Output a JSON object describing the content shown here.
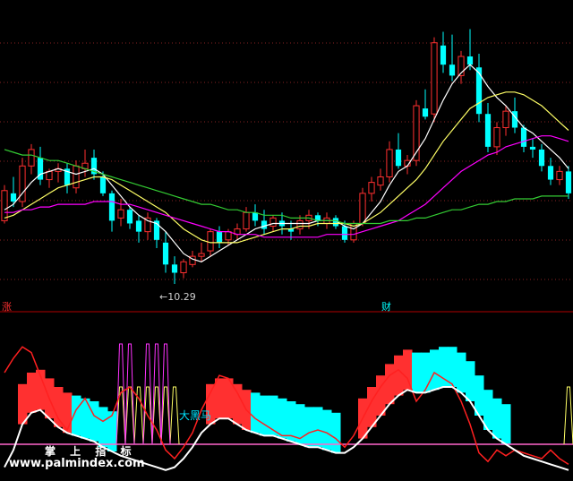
{
  "labels": {
    "rise_tag": "涨",
    "wealth_tag": "财",
    "signal_text": "大黑马",
    "low_price": "←10.29"
  },
  "watermark": {
    "title": "掌 上 指 标",
    "url": "www.palmindex.com"
  },
  "colors": {
    "background": "#000000",
    "up_candle": "#ff3030",
    "down_candle": "#00ffff",
    "ma_short": "#ffffff",
    "ma_mid": "#ffff66",
    "ma_long": "#ff00ff",
    "ma_longest": "#33cc33",
    "red_line": "#ff2020",
    "white_line": "#ffffff",
    "pink_baseline": "#ff66cc",
    "signal_yellow": "#ffff66",
    "signal_magenta": "#ff33ff",
    "grid": "#882222"
  },
  "chart_data": [
    {
      "type": "candlestick",
      "panel": "main",
      "ohlc": [
        [
          12.6,
          13.9,
          12.5,
          13.7
        ],
        [
          13.6,
          14.2,
          13.1,
          13.3
        ],
        [
          13.3,
          14.9,
          13.1,
          14.6
        ],
        [
          14.6,
          15.4,
          14.3,
          15.2
        ],
        [
          14.9,
          15.3,
          13.9,
          14.1
        ],
        [
          14.1,
          14.5,
          13.8,
          14.4
        ],
        [
          14.4,
          14.7,
          14.0,
          14.5
        ],
        [
          14.5,
          14.7,
          13.6,
          13.9
        ],
        [
          13.8,
          14.8,
          13.6,
          14.6
        ],
        [
          14.5,
          15.2,
          14.2,
          14.7
        ],
        [
          14.9,
          15.2,
          14.1,
          14.3
        ],
        [
          14.2,
          14.4,
          13.5,
          13.6
        ],
        [
          13.6,
          13.7,
          12.2,
          12.6
        ],
        [
          12.7,
          13.4,
          12.4,
          13.0
        ],
        [
          13.0,
          13.1,
          12.3,
          12.5
        ],
        [
          12.6,
          12.8,
          11.8,
          12.2
        ],
        [
          12.2,
          12.9,
          11.9,
          12.7
        ],
        [
          12.6,
          12.7,
          11.6,
          11.9
        ],
        [
          11.8,
          12.2,
          10.7,
          11.0
        ],
        [
          11.0,
          11.3,
          10.29,
          10.7
        ],
        [
          10.7,
          11.2,
          10.5,
          11.1
        ],
        [
          11.0,
          11.5,
          10.9,
          11.3
        ],
        [
          11.3,
          11.8,
          11.1,
          11.4
        ],
        [
          11.5,
          12.3,
          11.3,
          12.2
        ],
        [
          12.2,
          12.4,
          11.6,
          11.8
        ],
        [
          11.9,
          12.3,
          11.7,
          12.2
        ],
        [
          12.1,
          12.5,
          11.9,
          12.3
        ],
        [
          12.3,
          13.1,
          12.2,
          12.9
        ],
        [
          12.9,
          13.2,
          12.4,
          12.6
        ],
        [
          12.6,
          13.0,
          12.1,
          12.3
        ],
        [
          12.4,
          12.8,
          12.2,
          12.7
        ],
        [
          12.6,
          12.9,
          12.1,
          12.4
        ],
        [
          12.3,
          12.6,
          11.9,
          12.2
        ],
        [
          12.3,
          12.8,
          12.1,
          12.6
        ],
        [
          12.6,
          13.0,
          12.3,
          12.8
        ],
        [
          12.8,
          12.9,
          12.4,
          12.6
        ],
        [
          12.5,
          12.9,
          12.3,
          12.7
        ],
        [
          12.7,
          12.8,
          12.3,
          12.4
        ],
        [
          12.4,
          12.6,
          11.8,
          11.9
        ],
        [
          11.9,
          12.6,
          11.8,
          12.5
        ],
        [
          12.5,
          13.8,
          12.4,
          13.6
        ],
        [
          13.6,
          14.2,
          13.3,
          14.0
        ],
        [
          13.9,
          14.5,
          13.7,
          14.2
        ],
        [
          14.2,
          15.5,
          14.0,
          15.2
        ],
        [
          15.2,
          15.8,
          14.5,
          14.6
        ],
        [
          14.6,
          15.0,
          14.3,
          14.8
        ],
        [
          14.8,
          17.0,
          14.6,
          16.8
        ],
        [
          16.7,
          17.4,
          16.3,
          16.4
        ],
        [
          16.5,
          19.3,
          16.2,
          19.1
        ],
        [
          19.0,
          19.5,
          18.0,
          18.3
        ],
        [
          18.3,
          19.4,
          17.7,
          17.9
        ],
        [
          17.9,
          18.8,
          17.6,
          18.6
        ],
        [
          18.6,
          19.6,
          18.1,
          18.3
        ],
        [
          18.2,
          18.7,
          16.2,
          16.5
        ],
        [
          16.5,
          16.9,
          15.1,
          15.3
        ],
        [
          15.3,
          16.2,
          15.0,
          16.0
        ],
        [
          16.0,
          16.8,
          15.7,
          16.6
        ],
        [
          16.6,
          17.1,
          15.8,
          16.0
        ],
        [
          16.0,
          16.1,
          15.1,
          15.3
        ],
        [
          15.3,
          15.6,
          14.9,
          15.2
        ],
        [
          15.2,
          15.4,
          14.4,
          14.6
        ],
        [
          14.6,
          14.9,
          13.9,
          14.1
        ],
        [
          14.1,
          14.6,
          13.9,
          14.4
        ],
        [
          14.4,
          14.6,
          13.4,
          13.6
        ]
      ],
      "moving_averages": [
        {
          "color": "ma_short",
          "values": [
            13.0,
            13.2,
            13.6,
            14.0,
            14.3,
            14.4,
            14.5,
            14.4,
            14.3,
            14.4,
            14.5,
            14.3,
            13.9,
            13.5,
            13.1,
            12.8,
            12.6,
            12.5,
            12.2,
            11.8,
            11.4,
            11.2,
            11.1,
            11.3,
            11.5,
            11.7,
            11.9,
            12.1,
            12.3,
            12.4,
            12.5,
            12.5,
            12.5,
            12.5,
            12.5,
            12.6,
            12.6,
            12.6,
            12.4,
            12.3,
            12.5,
            12.9,
            13.3,
            13.9,
            14.4,
            14.6,
            15.1,
            15.6,
            16.3,
            17.0,
            17.6,
            18.0,
            18.3,
            18.0,
            17.5,
            17.1,
            16.8,
            16.4,
            16.0,
            15.8,
            15.5,
            15.2,
            14.9,
            14.5
          ]
        },
        {
          "color": "ma_mid",
          "values": [
            12.7,
            12.8,
            13.0,
            13.2,
            13.4,
            13.6,
            13.8,
            13.9,
            14.0,
            14.1,
            14.2,
            14.2,
            14.1,
            13.9,
            13.7,
            13.5,
            13.3,
            13.1,
            12.9,
            12.6,
            12.3,
            12.1,
            11.9,
            11.8,
            11.8,
            11.8,
            11.8,
            11.9,
            12.0,
            12.1,
            12.2,
            12.3,
            12.3,
            12.4,
            12.4,
            12.5,
            12.5,
            12.5,
            12.5,
            12.4,
            12.5,
            12.7,
            12.9,
            13.2,
            13.5,
            13.8,
            14.1,
            14.5,
            15.0,
            15.5,
            15.9,
            16.3,
            16.7,
            16.9,
            17.1,
            17.2,
            17.3,
            17.3,
            17.2,
            17.0,
            16.8,
            16.5,
            16.2,
            15.9
          ]
        },
        {
          "color": "ma_long",
          "values": [
            12.9,
            12.9,
            13.0,
            13.0,
            13.1,
            13.1,
            13.2,
            13.2,
            13.2,
            13.2,
            13.3,
            13.3,
            13.3,
            13.2,
            13.2,
            13.1,
            13.0,
            12.9,
            12.8,
            12.7,
            12.6,
            12.5,
            12.4,
            12.3,
            12.2,
            12.2,
            12.1,
            12.1,
            12.1,
            12.0,
            12.0,
            12.0,
            12.0,
            12.0,
            12.0,
            12.0,
            12.1,
            12.1,
            12.1,
            12.1,
            12.2,
            12.3,
            12.4,
            12.5,
            12.6,
            12.8,
            13.0,
            13.2,
            13.5,
            13.8,
            14.1,
            14.4,
            14.6,
            14.8,
            15.0,
            15.1,
            15.3,
            15.4,
            15.5,
            15.6,
            15.7,
            15.7,
            15.6,
            15.5
          ]
        },
        {
          "color": "ma_longest",
          "values": [
            15.2,
            15.1,
            15.0,
            15.0,
            14.9,
            14.8,
            14.8,
            14.7,
            14.6,
            14.5,
            14.4,
            14.3,
            14.2,
            14.1,
            14.0,
            13.9,
            13.8,
            13.7,
            13.6,
            13.5,
            13.4,
            13.3,
            13.2,
            13.2,
            13.1,
            13.0,
            13.0,
            12.9,
            12.9,
            12.8,
            12.8,
            12.8,
            12.7,
            12.7,
            12.7,
            12.6,
            12.6,
            12.6,
            12.5,
            12.5,
            12.5,
            12.5,
            12.5,
            12.6,
            12.6,
            12.6,
            12.7,
            12.7,
            12.8,
            12.9,
            13.0,
            13.0,
            13.1,
            13.2,
            13.2,
            13.3,
            13.3,
            13.4,
            13.4,
            13.4,
            13.5,
            13.5,
            13.5,
            13.5
          ]
        }
      ],
      "ylim": [
        9.8,
        20.4
      ],
      "annotations": [
        {
          "index": 19,
          "text": "←10.29"
        }
      ]
    },
    {
      "type": "line",
      "panel": "indicator",
      "ylim": [
        0,
        100
      ],
      "baseline": 20,
      "red_line": [
        70,
        80,
        88,
        84,
        68,
        52,
        38,
        30,
        44,
        52,
        40,
        36,
        40,
        56,
        60,
        52,
        40,
        30,
        16,
        10,
        18,
        28,
        44,
        56,
        68,
        66,
        56,
        44,
        38,
        34,
        30,
        26,
        26,
        24,
        28,
        30,
        28,
        24,
        18,
        26,
        38,
        50,
        60,
        68,
        72,
        66,
        50,
        58,
        70,
        66,
        62,
        50,
        34,
        14,
        8,
        16,
        12,
        16,
        14,
        12,
        10,
        16,
        10,
        6
      ],
      "white_line": [
        4,
        16,
        34,
        42,
        44,
        38,
        32,
        28,
        26,
        24,
        22,
        18,
        15,
        12,
        10,
        8,
        6,
        4,
        2,
        4,
        10,
        18,
        28,
        34,
        38,
        38,
        34,
        30,
        28,
        26,
        26,
        24,
        22,
        20,
        18,
        18,
        16,
        14,
        14,
        18,
        24,
        32,
        40,
        48,
        54,
        58,
        56,
        56,
        58,
        60,
        60,
        56,
        50,
        40,
        30,
        24,
        20,
        16,
        12,
        10,
        8,
        6,
        4,
        2
      ],
      "bands": [
        {
          "type": "red_up",
          "indices": [
            2,
            3,
            4,
            5,
            6,
            7,
            23,
            24,
            25,
            26,
            27,
            40,
            41,
            42,
            43,
            44,
            45
          ]
        },
        {
          "type": "cyan_down",
          "indices": [
            8,
            9,
            10,
            11,
            12,
            28,
            29,
            30,
            31,
            32,
            33,
            34,
            35,
            36,
            37,
            46,
            47,
            48,
            49,
            50,
            51,
            52,
            53,
            54,
            55,
            56
          ]
        },
        {
          "type": "yellow_signal",
          "indices": [
            13,
            14,
            15,
            16,
            17,
            18,
            19,
            63
          ]
        },
        {
          "type": "magenta_signal",
          "indices": [
            13,
            14,
            16,
            17,
            18
          ]
        }
      ]
    }
  ]
}
